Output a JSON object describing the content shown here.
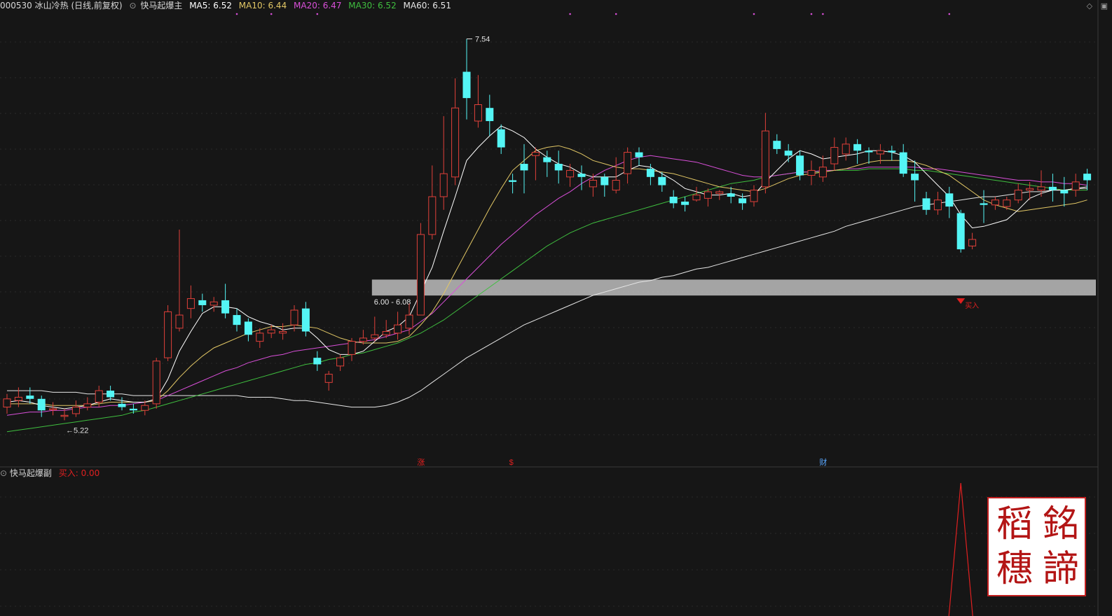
{
  "header": {
    "code_name": "000530 冰山冷热 (日线,前复权)",
    "indicator_name": "快马起爆主",
    "ma5_label": "MA5: 6.52",
    "ma10_label": "MA10: 6.44",
    "ma20_label": "MA20: 6.47",
    "ma30_label": "MA30: 6.52",
    "ma60_label": "MA60: 6.51"
  },
  "colors": {
    "bg": "#161616",
    "up": "#e0403a",
    "down": "#54f5f5",
    "ma5": "#ffffff",
    "ma10": "#e2c765",
    "ma20": "#d84fd8",
    "ma30": "#3fbf3f",
    "ma60": "#e6e6e6",
    "band": "#bdbdbd",
    "signal": "#e02020"
  },
  "main_chart": {
    "high_label": "7.54",
    "low_label": "5.22",
    "band_label": "6.00 - 6.08",
    "buy_marker_label": "买入",
    "event_marks": [
      "涨",
      "$",
      "财"
    ]
  },
  "sub_chart": {
    "name": "快马起爆副",
    "buy_label": "买入: 0.00"
  },
  "seal": {
    "chars": [
      "銘",
      "諦",
      "稻",
      "穗"
    ]
  },
  "chart_data": {
    "type": "candlestick",
    "price_range": [
      5.0,
      7.7
    ],
    "grid": true,
    "band": [
      6.0,
      6.08
    ],
    "candles": [
      [
        5.3,
        5.35,
        5.38,
        5.26
      ],
      [
        5.34,
        5.36,
        5.42,
        5.3
      ],
      [
        5.37,
        5.35,
        5.42,
        5.32
      ],
      [
        5.35,
        5.28,
        5.37,
        5.24
      ],
      [
        5.29,
        5.29,
        5.33,
        5.25
      ],
      [
        5.25,
        5.25,
        5.29,
        5.22
      ],
      [
        5.26,
        5.3,
        5.34,
        5.24
      ],
      [
        5.3,
        5.32,
        5.36,
        5.28
      ],
      [
        5.33,
        5.4,
        5.43,
        5.3
      ],
      [
        5.4,
        5.36,
        5.43,
        5.34
      ],
      [
        5.32,
        5.3,
        5.36,
        5.28
      ],
      [
        5.29,
        5.28,
        5.32,
        5.26
      ],
      [
        5.28,
        5.31,
        5.34,
        5.25
      ],
      [
        5.32,
        5.58,
        5.6,
        5.29
      ],
      [
        5.6,
        5.88,
        5.92,
        5.58
      ],
      [
        5.78,
        5.86,
        6.38,
        5.76
      ],
      [
        5.9,
        5.96,
        6.04,
        5.84
      ],
      [
        5.95,
        5.92,
        5.99,
        5.88
      ],
      [
        5.92,
        5.94,
        5.97,
        5.88
      ],
      [
        5.95,
        5.87,
        6.05,
        5.84
      ],
      [
        5.86,
        5.8,
        5.9,
        5.76
      ],
      [
        5.82,
        5.74,
        5.84,
        5.7
      ],
      [
        5.7,
        5.75,
        5.78,
        5.66
      ],
      [
        5.75,
        5.77,
        5.8,
        5.72
      ],
      [
        5.75,
        5.76,
        5.81,
        5.71
      ],
      [
        5.8,
        5.89,
        5.92,
        5.76
      ],
      [
        5.9,
        5.76,
        5.94,
        5.73
      ],
      [
        5.6,
        5.56,
        5.64,
        5.52
      ],
      [
        5.45,
        5.5,
        5.52,
        5.4
      ],
      [
        5.55,
        5.6,
        5.62,
        5.52
      ],
      [
        5.62,
        5.7,
        5.72,
        5.58
      ],
      [
        5.7,
        5.72,
        5.77,
        5.68
      ],
      [
        5.72,
        5.74,
        5.85,
        5.7
      ],
      [
        5.74,
        5.76,
        5.83,
        5.72
      ],
      [
        5.75,
        5.8,
        5.88,
        5.71
      ],
      [
        5.78,
        5.86,
        5.93,
        5.74
      ],
      [
        5.86,
        6.35,
        6.42,
        5.86
      ],
      [
        6.35,
        6.58,
        6.77,
        6.32
      ],
      [
        6.58,
        6.72,
        7.07,
        6.5
      ],
      [
        6.7,
        7.12,
        7.3,
        6.65
      ],
      [
        7.34,
        7.18,
        7.54,
        7.05
      ],
      [
        7.04,
        7.14,
        7.32,
        7.0
      ],
      [
        7.12,
        7.04,
        7.2,
        6.95
      ],
      [
        6.99,
        6.88,
        7.02,
        6.84
      ],
      [
        6.68,
        6.67,
        6.72,
        6.6
      ],
      [
        6.78,
        6.74,
        6.9,
        6.6
      ],
      [
        6.83,
        6.85,
        6.88,
        6.68
      ],
      [
        6.82,
        6.79,
        6.86,
        6.7
      ],
      [
        6.78,
        6.74,
        6.86,
        6.66
      ],
      [
        6.7,
        6.74,
        6.78,
        6.64
      ],
      [
        6.72,
        6.7,
        6.77,
        6.62
      ],
      [
        6.64,
        6.68,
        6.72,
        6.58
      ],
      [
        6.7,
        6.65,
        6.72,
        6.58
      ],
      [
        6.62,
        6.68,
        6.82,
        6.6
      ],
      [
        6.72,
        6.85,
        6.88,
        6.66
      ],
      [
        6.85,
        6.82,
        6.88,
        6.77
      ],
      [
        6.75,
        6.7,
        6.78,
        6.65
      ],
      [
        6.7,
        6.65,
        6.73,
        6.61
      ],
      [
        6.58,
        6.54,
        6.62,
        6.51
      ],
      [
        6.55,
        6.53,
        6.58,
        6.49
      ],
      [
        6.56,
        6.59,
        6.64,
        6.55
      ],
      [
        6.57,
        6.61,
        6.63,
        6.52
      ],
      [
        6.6,
        6.61,
        6.62,
        6.56
      ],
      [
        6.6,
        6.58,
        6.64,
        6.54
      ],
      [
        6.57,
        6.54,
        6.6,
        6.5
      ],
      [
        6.55,
        6.62,
        6.65,
        6.52
      ],
      [
        6.64,
        6.98,
        7.09,
        6.6
      ],
      [
        6.92,
        6.87,
        6.96,
        6.84
      ],
      [
        6.86,
        6.83,
        6.9,
        6.79
      ],
      [
        6.83,
        6.71,
        6.86,
        6.68
      ],
      [
        6.71,
        6.74,
        6.8,
        6.65
      ],
      [
        6.7,
        6.76,
        6.83,
        6.67
      ],
      [
        6.78,
        6.88,
        6.94,
        6.74
      ],
      [
        6.84,
        6.9,
        6.94,
        6.8
      ],
      [
        6.9,
        6.86,
        6.93,
        6.78
      ],
      [
        6.86,
        6.85,
        6.88,
        6.78
      ],
      [
        6.84,
        6.86,
        6.9,
        6.78
      ],
      [
        6.86,
        6.85,
        6.89,
        6.8
      ],
      [
        6.85,
        6.72,
        6.9,
        6.7
      ],
      [
        6.72,
        6.68,
        6.8,
        6.55
      ],
      [
        6.57,
        6.5,
        6.61,
        6.47
      ],
      [
        6.5,
        6.56,
        6.61,
        6.47
      ],
      [
        6.6,
        6.52,
        6.64,
        6.45
      ],
      [
        6.48,
        6.26,
        6.5,
        6.24
      ],
      [
        6.28,
        6.32,
        6.36,
        6.26
      ],
      [
        6.54,
        6.53,
        6.62,
        6.42
      ],
      [
        6.53,
        6.56,
        6.58,
        6.5
      ],
      [
        6.52,
        6.56,
        6.58,
        6.5
      ],
      [
        6.56,
        6.62,
        6.66,
        6.54
      ],
      [
        6.62,
        6.63,
        6.67,
        6.56
      ],
      [
        6.62,
        6.64,
        6.74,
        6.58
      ],
      [
        6.64,
        6.62,
        6.72,
        6.55
      ],
      [
        6.62,
        6.6,
        6.7,
        6.52
      ],
      [
        6.62,
        6.67,
        6.72,
        6.58
      ],
      [
        6.72,
        6.68,
        6.75,
        6.62
      ]
    ],
    "ma5": [
      5.33,
      5.34,
      5.33,
      5.31,
      5.3,
      5.29,
      5.3,
      5.31,
      5.33,
      5.35,
      5.34,
      5.33,
      5.33,
      5.35,
      5.47,
      5.64,
      5.76,
      5.87,
      5.91,
      5.91,
      5.9,
      5.85,
      5.82,
      5.8,
      5.77,
      5.78,
      5.78,
      5.72,
      5.65,
      5.62,
      5.62,
      5.64,
      5.7,
      5.76,
      5.79,
      5.85,
      6.0,
      6.15,
      6.37,
      6.58,
      6.8,
      6.88,
      6.95,
      7.01,
      6.98,
      6.94,
      6.87,
      6.82,
      6.78,
      6.76,
      6.72,
      6.7,
      6.7,
      6.7,
      6.74,
      6.77,
      6.76,
      6.72,
      6.68,
      6.63,
      6.61,
      6.59,
      6.59,
      6.6,
      6.58,
      6.59,
      6.67,
      6.74,
      6.81,
      6.86,
      6.84,
      6.81,
      6.82,
      6.83,
      6.84,
      6.86,
      6.86,
      6.85,
      6.83,
      6.79,
      6.72,
      6.65,
      6.58,
      6.47,
      6.39,
      6.4,
      6.42,
      6.44,
      6.5,
      6.57,
      6.6,
      6.62,
      6.62,
      6.63,
      6.64
    ],
    "ma10": [
      5.32,
      5.32,
      5.32,
      5.32,
      5.31,
      5.31,
      5.31,
      5.31,
      5.32,
      5.33,
      5.33,
      5.33,
      5.33,
      5.34,
      5.4,
      5.48,
      5.55,
      5.61,
      5.66,
      5.69,
      5.72,
      5.75,
      5.77,
      5.79,
      5.79,
      5.8,
      5.79,
      5.78,
      5.75,
      5.72,
      5.7,
      5.69,
      5.69,
      5.69,
      5.7,
      5.73,
      5.8,
      5.88,
      5.99,
      6.12,
      6.25,
      6.38,
      6.51,
      6.63,
      6.74,
      6.8,
      6.86,
      6.88,
      6.89,
      6.87,
      6.84,
      6.8,
      6.78,
      6.76,
      6.75,
      6.75,
      6.74,
      6.73,
      6.72,
      6.7,
      6.68,
      6.66,
      6.64,
      6.63,
      6.62,
      6.61,
      6.63,
      6.66,
      6.69,
      6.71,
      6.72,
      6.73,
      6.74,
      6.75,
      6.77,
      6.79,
      6.8,
      6.8,
      6.8,
      6.79,
      6.77,
      6.74,
      6.71,
      6.66,
      6.61,
      6.56,
      6.53,
      6.51,
      6.49,
      6.5,
      6.51,
      6.52,
      6.53,
      6.54,
      6.56
    ],
    "ma20": [
      5.25,
      5.26,
      5.27,
      5.27,
      5.28,
      5.28,
      5.29,
      5.3,
      5.3,
      5.31,
      5.31,
      5.32,
      5.33,
      5.34,
      5.37,
      5.4,
      5.43,
      5.46,
      5.49,
      5.52,
      5.54,
      5.57,
      5.59,
      5.61,
      5.62,
      5.64,
      5.65,
      5.66,
      5.67,
      5.68,
      5.69,
      5.7,
      5.71,
      5.73,
      5.75,
      5.77,
      5.82,
      5.87,
      5.94,
      6.01,
      6.08,
      6.15,
      6.22,
      6.29,
      6.35,
      6.41,
      6.47,
      6.52,
      6.57,
      6.61,
      6.66,
      6.7,
      6.74,
      6.77,
      6.8,
      6.82,
      6.83,
      6.82,
      6.81,
      6.8,
      6.79,
      6.77,
      6.75,
      6.73,
      6.71,
      6.7,
      6.7,
      6.71,
      6.72,
      6.73,
      6.73,
      6.74,
      6.74,
      6.75,
      6.75,
      6.76,
      6.76,
      6.76,
      6.76,
      6.76,
      6.75,
      6.75,
      6.74,
      6.73,
      6.72,
      6.71,
      6.7,
      6.69,
      6.68,
      6.68,
      6.67,
      6.67,
      6.66,
      6.66,
      6.65
    ],
    "ma30": [
      5.15,
      5.16,
      5.17,
      5.18,
      5.19,
      5.2,
      5.21,
      5.22,
      5.23,
      5.24,
      5.25,
      5.27,
      5.28,
      5.3,
      5.32,
      5.34,
      5.36,
      5.38,
      5.4,
      5.42,
      5.44,
      5.46,
      5.48,
      5.5,
      5.52,
      5.54,
      5.56,
      5.57,
      5.59,
      5.6,
      5.62,
      5.63,
      5.65,
      5.67,
      5.69,
      5.72,
      5.75,
      5.79,
      5.83,
      5.88,
      5.93,
      5.98,
      6.03,
      6.08,
      6.13,
      6.18,
      6.23,
      6.28,
      6.32,
      6.36,
      6.39,
      6.42,
      6.44,
      6.46,
      6.48,
      6.5,
      6.52,
      6.54,
      6.56,
      6.58,
      6.6,
      6.62,
      6.64,
      6.66,
      6.67,
      6.68,
      6.7,
      6.71,
      6.72,
      6.73,
      6.73,
      6.73,
      6.74,
      6.74,
      6.74,
      6.75,
      6.75,
      6.75,
      6.75,
      6.74,
      6.74,
      6.73,
      6.72,
      6.71,
      6.7,
      6.69,
      6.68,
      6.67,
      6.66,
      6.65,
      6.64,
      6.63,
      6.62,
      6.62,
      6.62
    ],
    "ma60": [
      5.4,
      5.4,
      5.4,
      5.4,
      5.39,
      5.39,
      5.39,
      5.38,
      5.38,
      5.38,
      5.38,
      5.37,
      5.37,
      5.37,
      5.37,
      5.37,
      5.37,
      5.37,
      5.37,
      5.37,
      5.37,
      5.36,
      5.36,
      5.36,
      5.35,
      5.34,
      5.34,
      5.33,
      5.32,
      5.31,
      5.3,
      5.3,
      5.3,
      5.31,
      5.33,
      5.36,
      5.4,
      5.45,
      5.5,
      5.55,
      5.6,
      5.64,
      5.68,
      5.72,
      5.76,
      5.8,
      5.83,
      5.86,
      5.89,
      5.92,
      5.95,
      5.98,
      6.0,
      6.02,
      6.04,
      6.06,
      6.07,
      6.09,
      6.1,
      6.12,
      6.14,
      6.15,
      6.17,
      6.19,
      6.21,
      6.23,
      6.25,
      6.27,
      6.29,
      6.31,
      6.33,
      6.35,
      6.37,
      6.4,
      6.42,
      6.44,
      6.46,
      6.48,
      6.5,
      6.52,
      6.53,
      6.54,
      6.55,
      6.56,
      6.57,
      6.58,
      6.58,
      6.59,
      6.6,
      6.61,
      6.61,
      6.62,
      6.62,
      6.63,
      6.63
    ],
    "sub_signal": {
      "buy_index": 83,
      "peak_value": 1.0
    }
  }
}
